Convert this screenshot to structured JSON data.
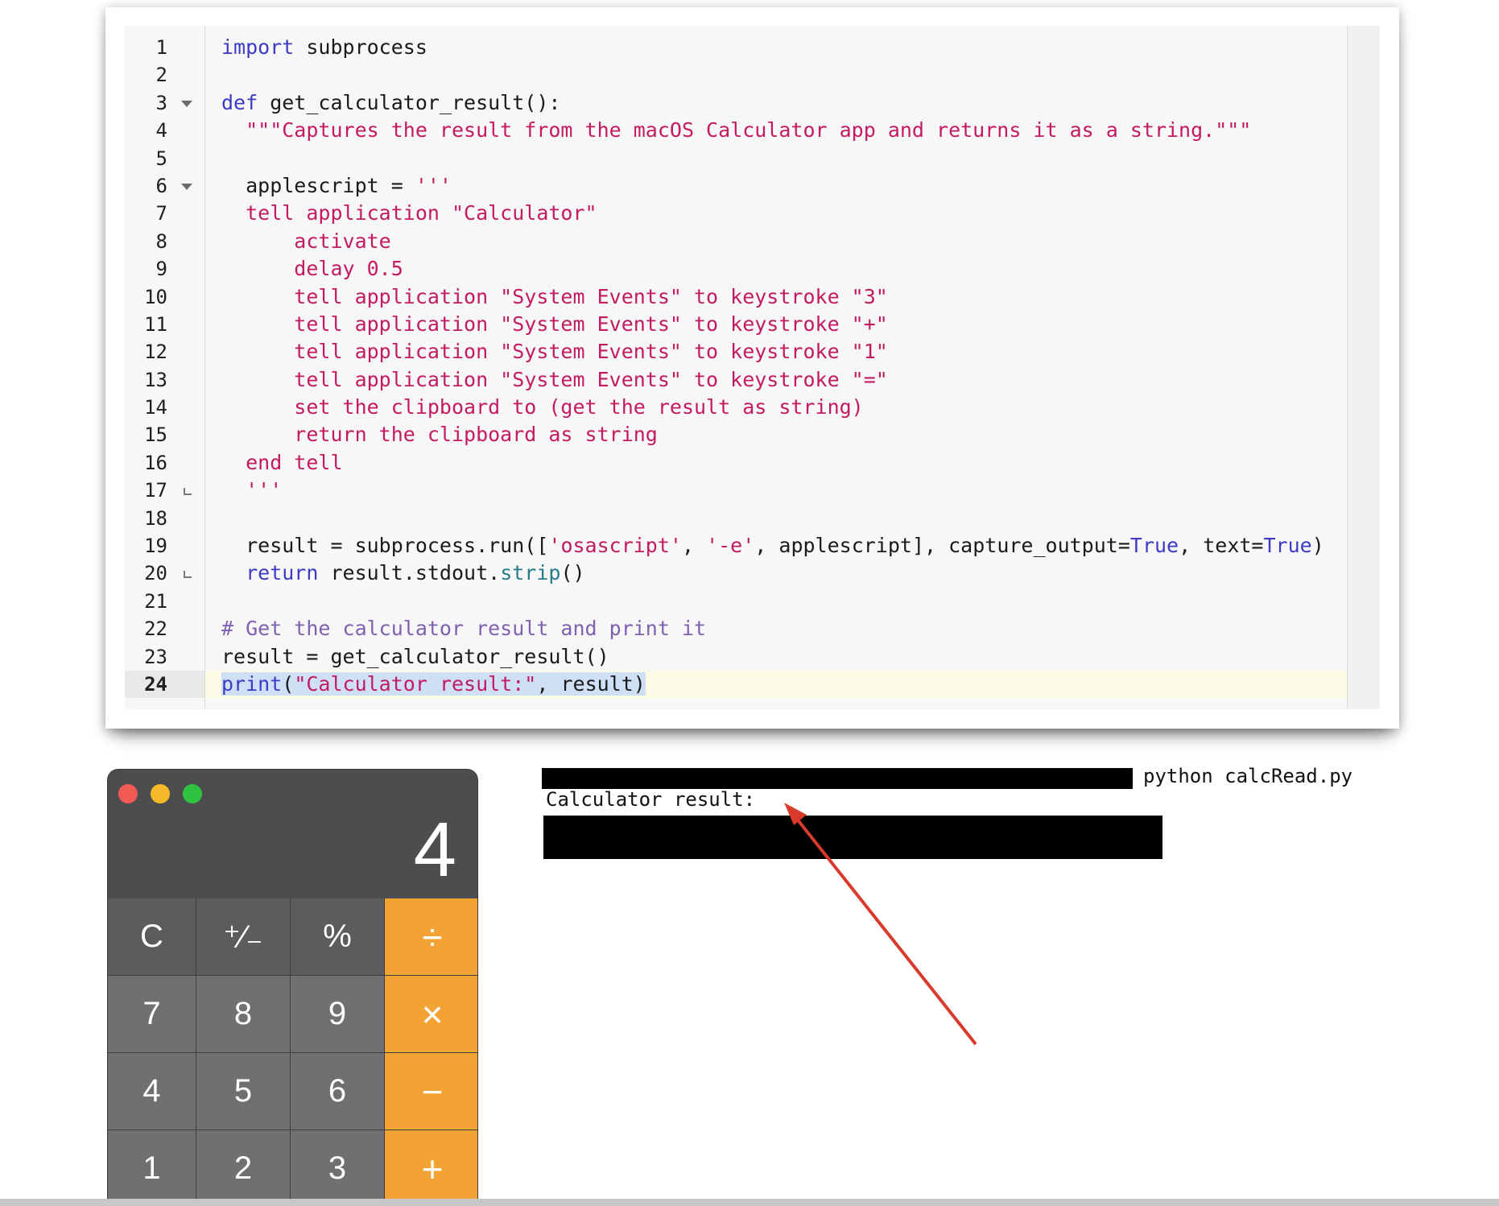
{
  "editor": {
    "current_line": 24,
    "line_numbers": [
      "1",
      "2",
      "3",
      "4",
      "5",
      "6",
      "7",
      "8",
      "9",
      "10",
      "11",
      "12",
      "13",
      "14",
      "15",
      "16",
      "17",
      "18",
      "19",
      "20",
      "21",
      "22",
      "23",
      "24"
    ]
  },
  "code": {
    "l1_kw": "import",
    "l1_rest": " subprocess",
    "l3_kw": "def",
    "l3_rest": " get_calculator_result():",
    "l4": "  \"\"\"Captures the result from the macOS Calculator app and returns it as a string.\"\"\"",
    "l6_a": "  applescript = ",
    "l6_b": "'''",
    "l7": "  tell application \"Calculator\"",
    "l8": "      activate",
    "l9": "      delay 0.5",
    "l10": "      tell application \"System Events\" to keystroke \"3\"",
    "l11": "      tell application \"System Events\" to keystroke \"+\"",
    "l12": "      tell application \"System Events\" to keystroke \"1\"",
    "l13": "      tell application \"System Events\" to keystroke \"=\"",
    "l14": "      set the clipboard to (get the result as string)",
    "l15": "      return the clipboard as string",
    "l16": "  end tell",
    "l17": "  '''",
    "l19_a": "  result = subprocess.run([",
    "l19_s1": "'osascript'",
    "l19_b": ", ",
    "l19_s2": "'-e'",
    "l19_c": ", applescript], capture_output=",
    "l19_t1": "True",
    "l19_d": ", text=",
    "l19_t2": "True",
    "l19_e": ")",
    "l20_kw": "  return",
    "l20_a": " result.stdout.",
    "l20_m": "strip",
    "l20_b": "()",
    "l22": "# Get the calculator result and print it",
    "l23": "result = get_calculator_result()",
    "l24_fn": "print",
    "l24_a": "(",
    "l24_s": "\"Calculator result:\"",
    "l24_b": ", result)"
  },
  "calculator": {
    "display": "4",
    "keys": [
      [
        "C",
        "⁺∕₋",
        "%",
        "÷"
      ],
      [
        "7",
        "8",
        "9",
        "×"
      ],
      [
        "4",
        "5",
        "6",
        "−"
      ],
      [
        "1",
        "2",
        "3",
        "+"
      ]
    ]
  },
  "terminal": {
    "command": "python calcRead.py",
    "output": "Calculator result:"
  },
  "colors": {
    "annotation_arrow": "#d93a2b",
    "calculator_operator": "#f3a234"
  }
}
